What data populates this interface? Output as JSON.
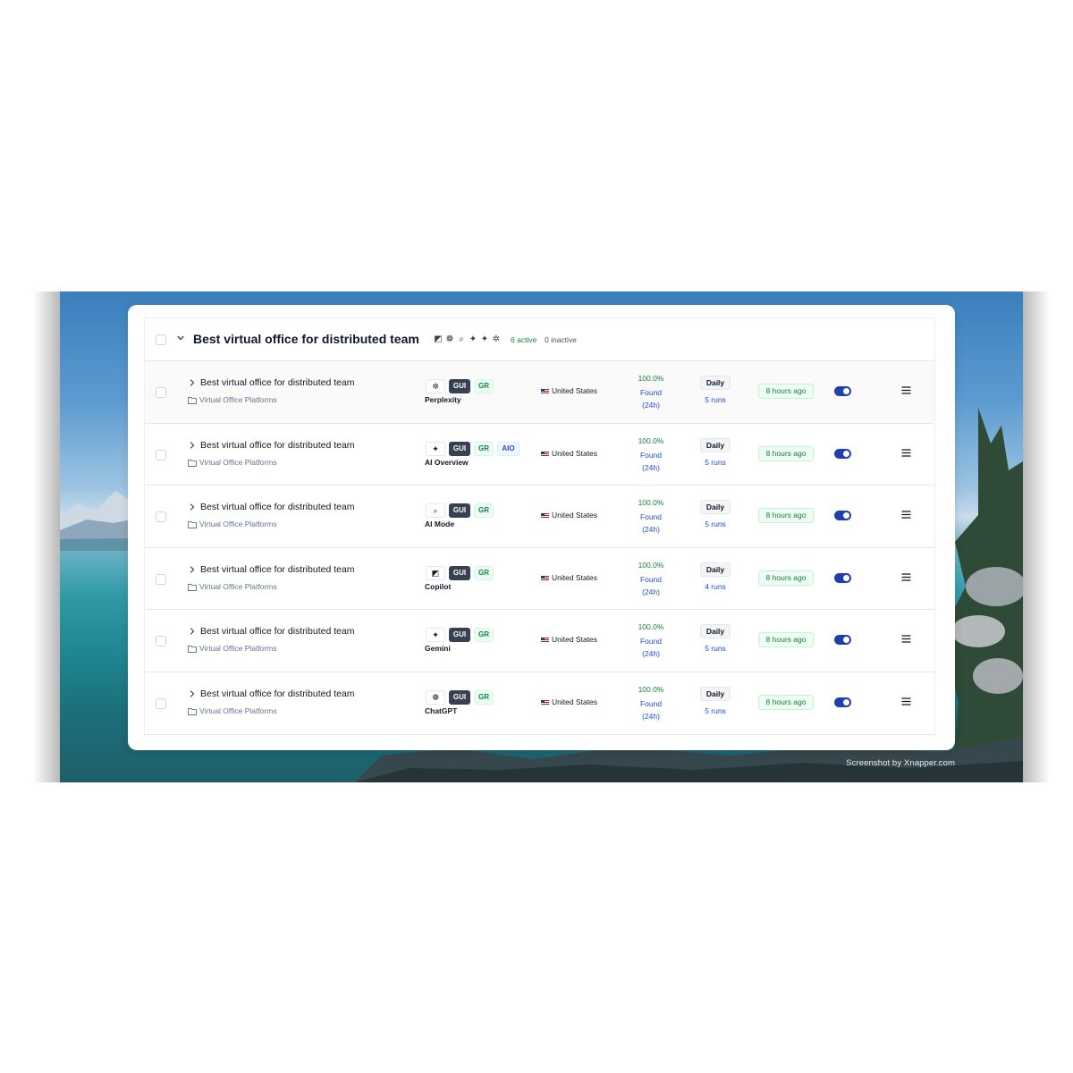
{
  "group": {
    "title": "Best virtual office for distributed team",
    "engine_icons": [
      "copilot-icon",
      "chatgpt-icon",
      "ai-mode-icon",
      "ai-overview-icon",
      "gemini-icon",
      "perplexity-icon"
    ],
    "active": "6 active",
    "inactive": "0 inactive"
  },
  "rows": [
    {
      "title": "Best virtual office for distributed team",
      "category": "Virtual Office Platforms",
      "engine": "Perplexity",
      "engine_icon": "perplexity-icon",
      "tags": [
        "GUI",
        "GR"
      ],
      "country": "United States",
      "percent": "100.0%",
      "found": "Found",
      "window": "(24h)",
      "frequency": "Daily",
      "runs": "5 runs",
      "last_run": "8 hours ago",
      "enabled": true
    },
    {
      "title": "Best virtual office for distributed team",
      "category": "Virtual Office Platforms",
      "engine": "AI Overview",
      "engine_icon": "ai-overview-icon",
      "tags": [
        "GUI",
        "GR",
        "AIO"
      ],
      "country": "United States",
      "percent": "100.0%",
      "found": "Found",
      "window": "(24h)",
      "frequency": "Daily",
      "runs": "5 runs",
      "last_run": "8 hours ago",
      "enabled": true
    },
    {
      "title": "Best virtual office for distributed team",
      "category": "Virtual Office Platforms",
      "engine": "AI Mode",
      "engine_icon": "ai-mode-icon",
      "tags": [
        "GUI",
        "GR"
      ],
      "country": "United States",
      "percent": "100.0%",
      "found": "Found",
      "window": "(24h)",
      "frequency": "Daily",
      "runs": "5 runs",
      "last_run": "8 hours ago",
      "enabled": true
    },
    {
      "title": "Best virtual office for distributed team",
      "category": "Virtual Office Platforms",
      "engine": "Copilot",
      "engine_icon": "copilot-icon",
      "tags": [
        "GUI",
        "GR"
      ],
      "country": "United States",
      "percent": "100.0%",
      "found": "Found",
      "window": "(24h)",
      "frequency": "Daily",
      "runs": "4 runs",
      "last_run": "8 hours ago",
      "enabled": true
    },
    {
      "title": "Best virtual office for distributed team",
      "category": "Virtual Office Platforms",
      "engine": "Gemini",
      "engine_icon": "gemini-icon",
      "tags": [
        "GUI",
        "GR"
      ],
      "country": "United States",
      "percent": "100.0%",
      "found": "Found",
      "window": "(24h)",
      "frequency": "Daily",
      "runs": "5 runs",
      "last_run": "8 hours ago",
      "enabled": true
    },
    {
      "title": "Best virtual office for distributed team",
      "category": "Virtual Office Platforms",
      "engine": "ChatGPT",
      "engine_icon": "chatgpt-icon",
      "tags": [
        "GUI",
        "GR"
      ],
      "country": "United States",
      "percent": "100.0%",
      "found": "Found",
      "window": "(24h)",
      "frequency": "Daily",
      "runs": "5 runs",
      "last_run": "8 hours ago",
      "enabled": true
    }
  ],
  "watermark": "Screenshot by Xnapper.com",
  "colors": {
    "accent": "#1e40af",
    "success": "#15803d",
    "link": "#1d4ed8"
  }
}
